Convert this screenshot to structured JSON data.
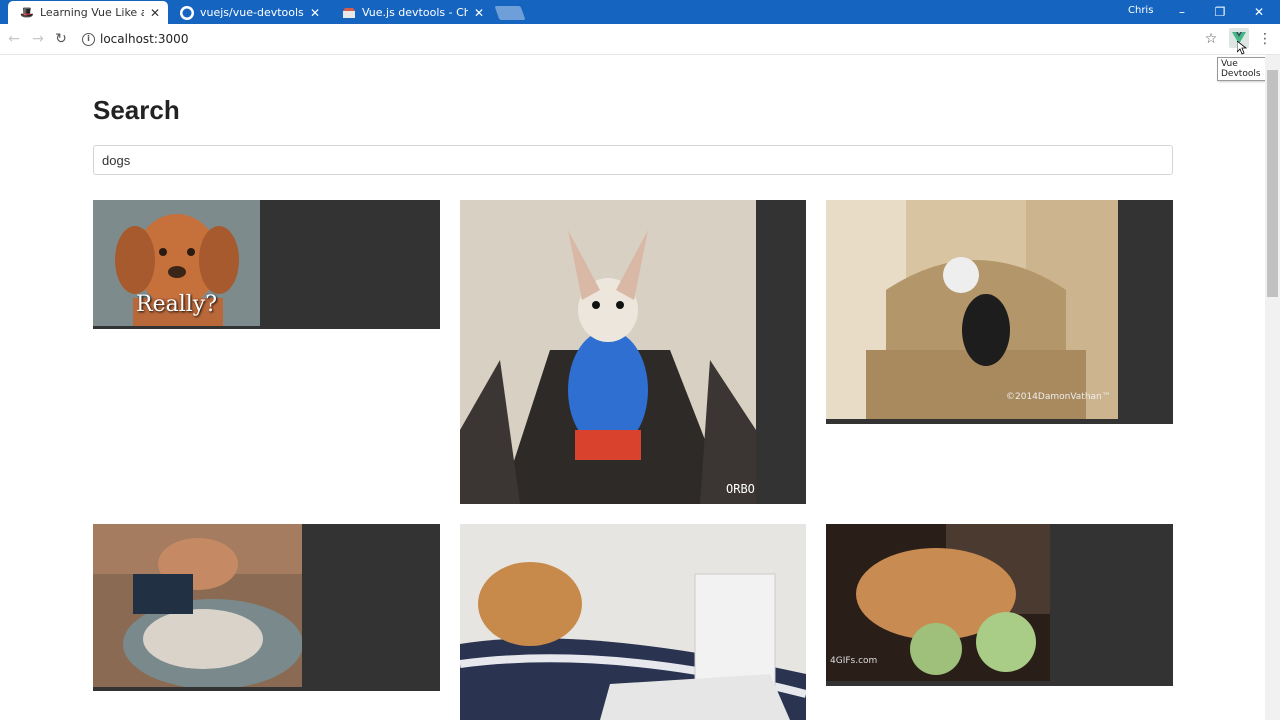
{
  "browser": {
    "tabs": [
      {
        "title": "Learning Vue Like a Boss",
        "active": true
      },
      {
        "title": "vuejs/vue-devtools: ⚙ ",
        "active": false
      },
      {
        "title": "Vue.js devtools - Chrome",
        "active": false
      }
    ],
    "user": "Chris",
    "url": "localhost:3000",
    "extension_tooltip": "Vue Devtools"
  },
  "page": {
    "title": "Search",
    "search_value": "dogs"
  },
  "gifs": [
    {
      "caption": "Really?"
    },
    {
      "caption": "ORBO"
    },
    {
      "caption": "©2014DamonVathan™"
    },
    {
      "caption": ""
    },
    {
      "caption": ""
    },
    {
      "caption": "4GIFs.com"
    }
  ],
  "colors": {
    "titlebar": "#1565c0",
    "card_bg": "#333333"
  }
}
